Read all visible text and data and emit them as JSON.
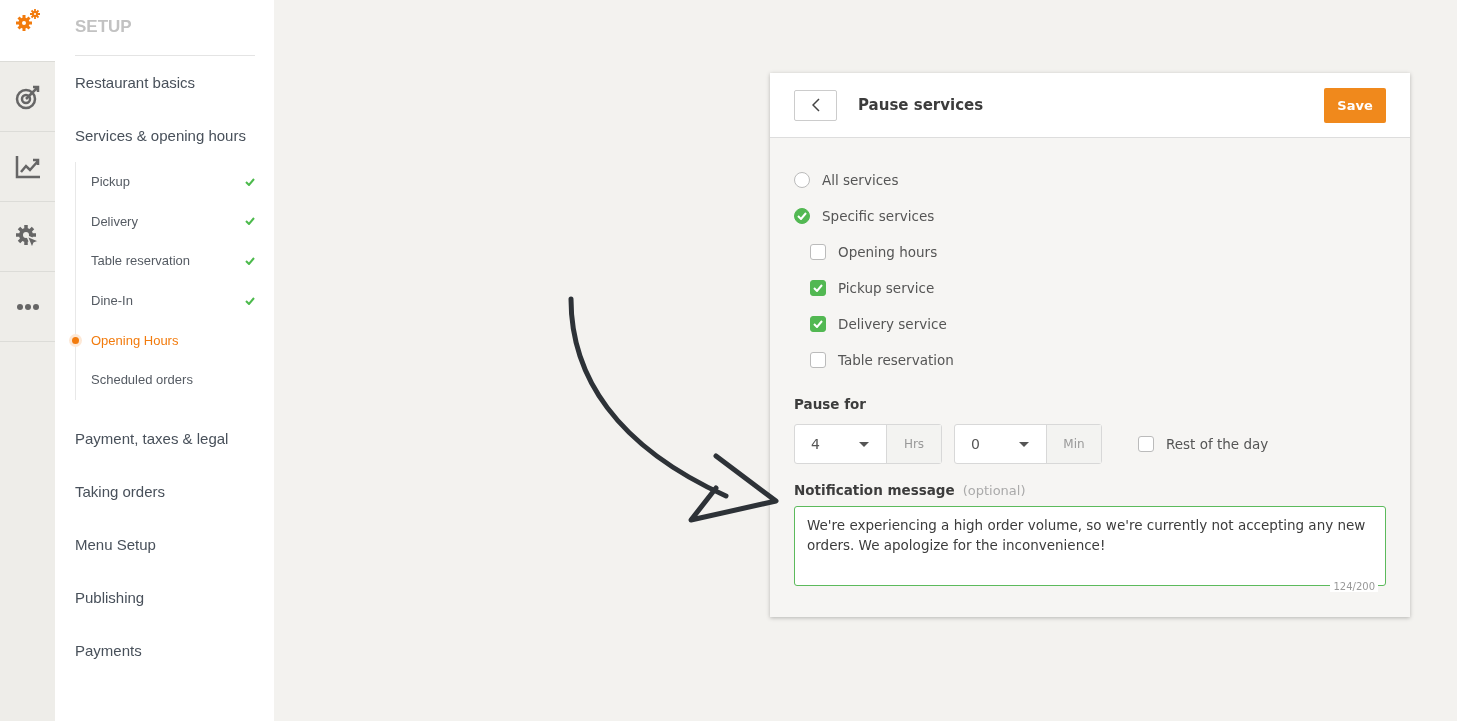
{
  "rail": [
    {
      "kind": "gears",
      "selected": true
    },
    {
      "kind": "target",
      "selected": false
    },
    {
      "kind": "chart",
      "selected": false
    },
    {
      "kind": "gear-cursor",
      "selected": false
    },
    {
      "kind": "more",
      "selected": false
    }
  ],
  "sidebar": {
    "title": "SETUP",
    "items": [
      {
        "label": "Restaurant basics",
        "selected": false
      },
      {
        "label": "Services & opening hours",
        "selected": false,
        "children": [
          {
            "label": "Pickup",
            "done": true,
            "selected": false
          },
          {
            "label": "Delivery",
            "done": true,
            "selected": false
          },
          {
            "label": "Table reservation",
            "done": true,
            "selected": false
          },
          {
            "label": "Dine-In",
            "done": true,
            "selected": false
          },
          {
            "label": "Opening Hours",
            "done": false,
            "selected": true
          },
          {
            "label": "Scheduled orders",
            "done": false,
            "selected": false
          }
        ]
      },
      {
        "label": "Payment, taxes & legal",
        "selected": false
      },
      {
        "label": "Taking orders",
        "selected": false
      },
      {
        "label": "Menu Setup",
        "selected": false
      },
      {
        "label": "Publishing",
        "selected": false
      },
      {
        "label": "Payments",
        "selected": false
      }
    ]
  },
  "dialog": {
    "title": "Pause services",
    "save": "Save",
    "scope": [
      {
        "label": "All services",
        "selected": false
      },
      {
        "label": "Specific services",
        "selected": true
      }
    ],
    "services": [
      {
        "label": "Opening hours",
        "checked": false
      },
      {
        "label": "Pickup service",
        "checked": true
      },
      {
        "label": "Delivery service",
        "checked": true
      },
      {
        "label": "Table reservation",
        "checked": false
      }
    ],
    "pause_for": {
      "label": "Pause for",
      "hours": {
        "value": "4",
        "unit": "Hrs"
      },
      "minutes": {
        "value": "0",
        "unit": "Min"
      },
      "rest_of_day": {
        "label": "Rest of the day",
        "checked": false
      }
    },
    "message": {
      "label": "Notification message",
      "hint": "(optional)",
      "value": "We're experiencing a high order volume, so we're currently not accepting any new orders. We apologize for the inconvenience!",
      "counter": "124/200"
    }
  }
}
